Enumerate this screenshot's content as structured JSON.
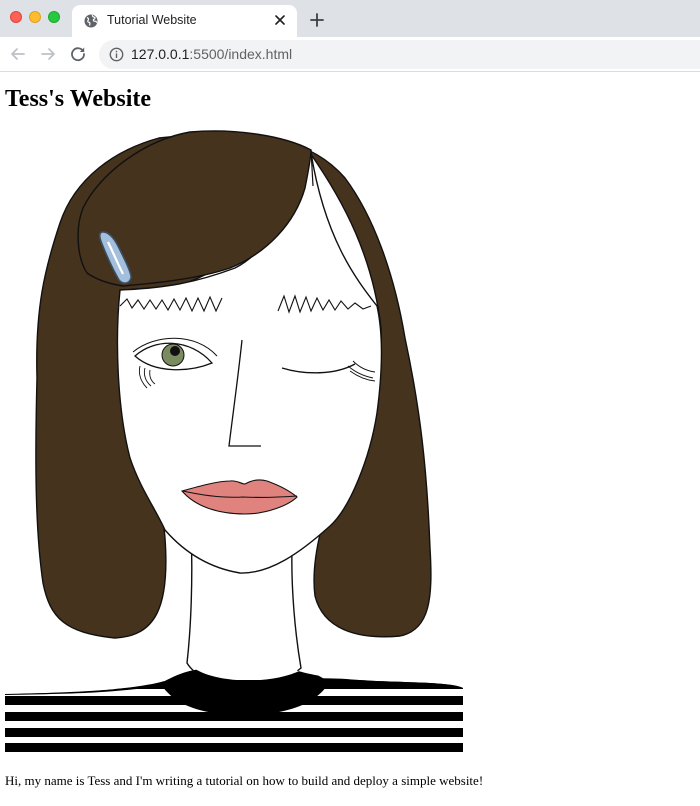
{
  "browser": {
    "tab_title": "Tutorial Website",
    "url_host": "127.0.0.1",
    "url_rest": ":5500/index.html"
  },
  "page": {
    "heading": "Tess's Website",
    "intro": "Hi, my name is Tess and I'm writing a tutorial on how to build and deploy a simple website!"
  },
  "icons": {
    "tab": "globe-icon",
    "close": "close-icon",
    "new_tab": "plus-icon",
    "back": "back-arrow-icon",
    "forward": "forward-arrow-icon",
    "reload": "reload-icon",
    "site_info": "info-icon"
  },
  "colors": {
    "hair": "#45331d",
    "iris": "#7b8b60",
    "lips": "#e0837f",
    "hair_clip": "#a3bfdc",
    "stripes": "#000000",
    "tab_strip": "#dee1e6",
    "omnibox": "#f1f3f4"
  }
}
